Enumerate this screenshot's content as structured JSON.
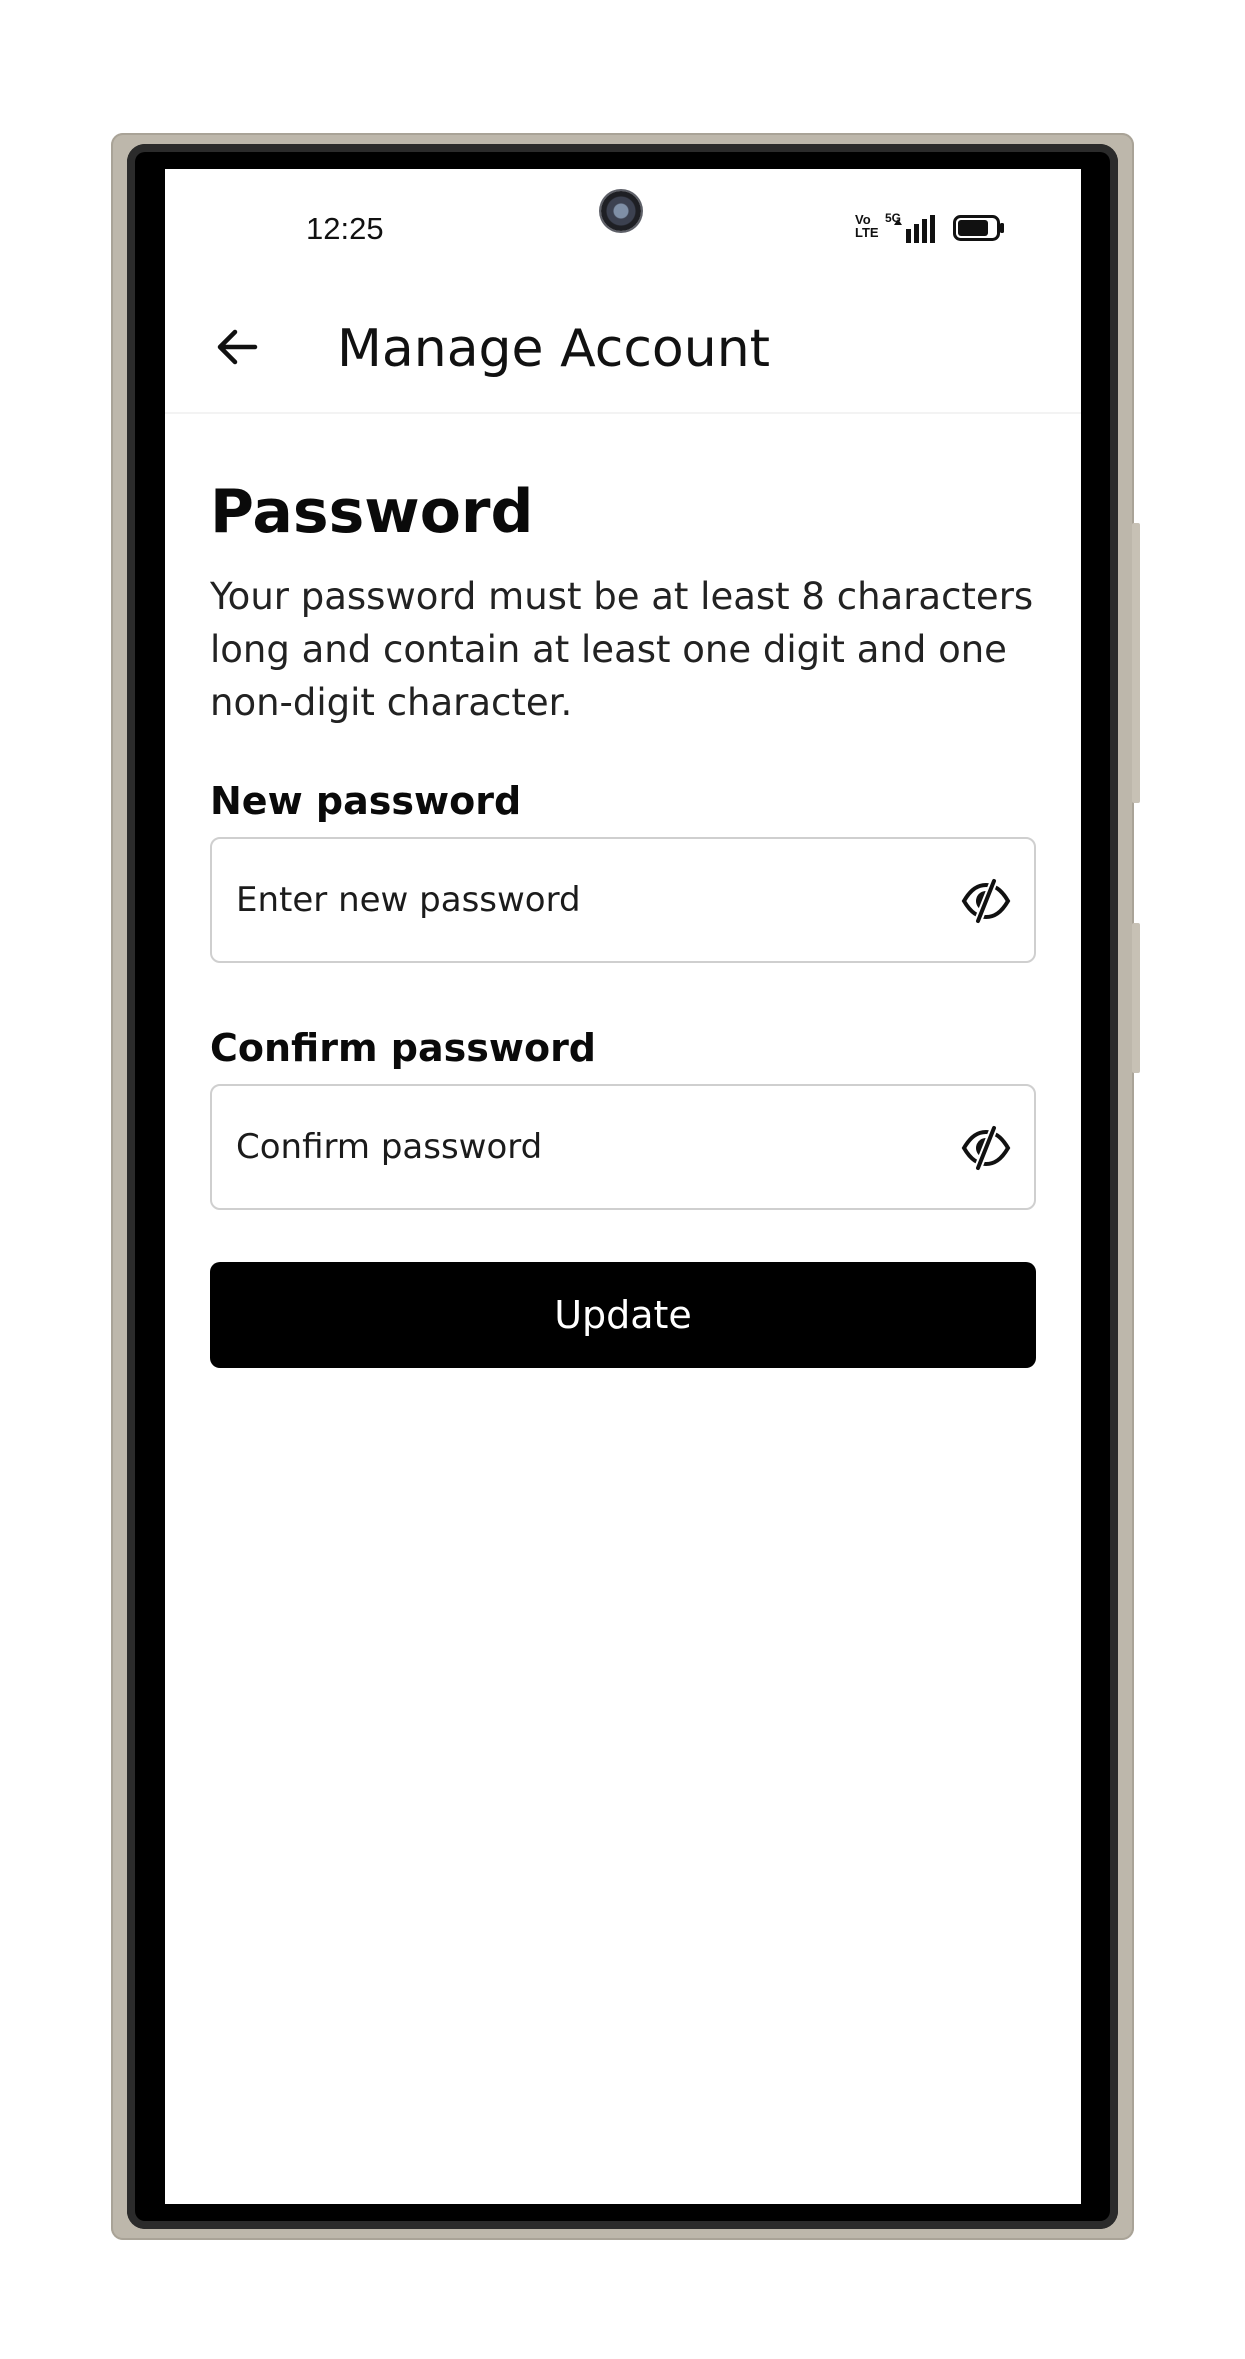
{
  "status_bar": {
    "time": "12:25",
    "volte_label": "Vo\nLTE",
    "network_label": "5G",
    "battery_level": 0.8
  },
  "app_bar": {
    "title": "Manage Account",
    "back_icon": "arrow-left-icon"
  },
  "page": {
    "heading": "Password",
    "description": "Your password must be at least 8 characters long and contain at least one digit and one non-digit character.",
    "new_password": {
      "label": "New password",
      "placeholder": "Enter new password",
      "value": "",
      "toggle_icon": "eye-off-icon"
    },
    "confirm_password": {
      "label": "Confirm password",
      "placeholder": "Confirm password",
      "value": "",
      "toggle_icon": "eye-off-icon"
    },
    "submit_label": "Update"
  },
  "colors": {
    "button_bg": "#000000",
    "button_text": "#ffffff",
    "input_border": "#cfcfcf",
    "phone_frame": "#bdb7ab"
  }
}
